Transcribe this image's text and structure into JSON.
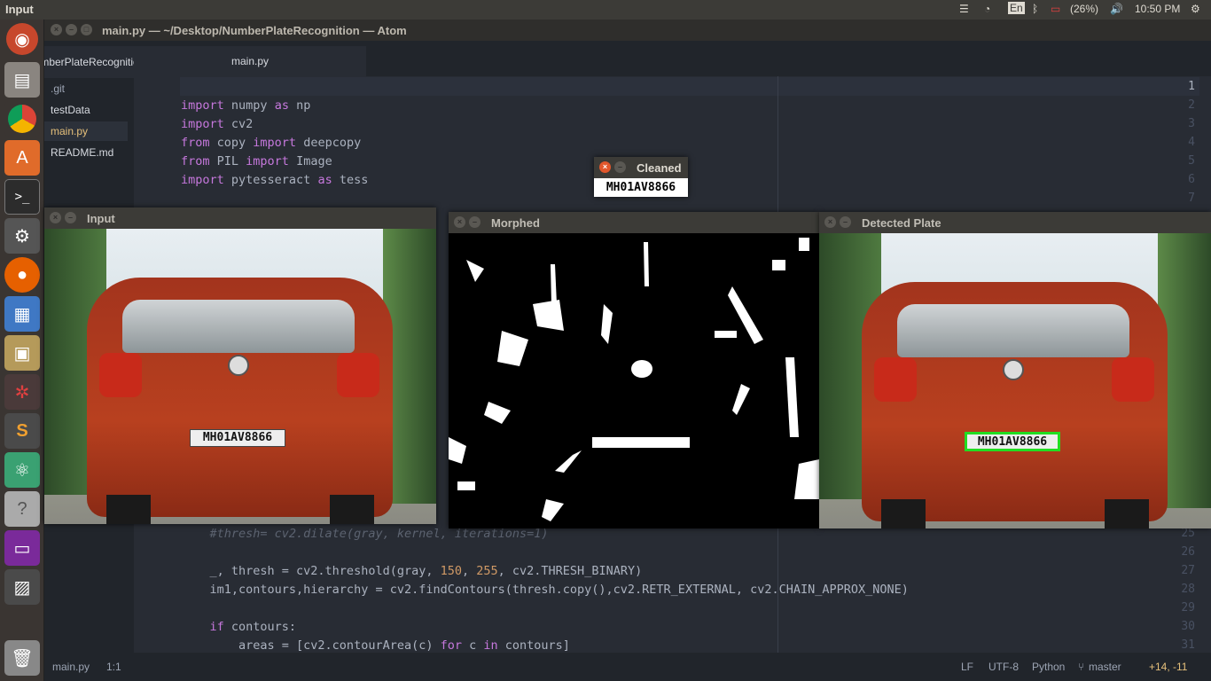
{
  "topbar": {
    "app_name": "Input",
    "keyboard": "En",
    "battery": "(26%)",
    "time": "10:50 PM"
  },
  "launcher": {
    "items": [
      "ubuntu-dash-icon",
      "files-icon",
      "chrome-icon",
      "software-center-icon",
      "terminal-icon",
      "settings-icon",
      "firefox-icon",
      "document-viewer-icon",
      "archive-icon",
      "unity-tweak-icon",
      "sublime-icon",
      "atom-icon",
      "help-icon",
      "window-icon",
      "workspace-icon",
      "trash-icon"
    ]
  },
  "atom": {
    "title": "main.py — ~/Desktop/NumberPlateRecognition — Atom",
    "tree_root": "NumberPlateRecognition",
    "tree_items": [
      ".git",
      "testData",
      "main.py",
      "README.md"
    ],
    "tab": "main.py"
  },
  "code": {
    "top_lines": [
      {
        "n": "1",
        "text": ""
      },
      {
        "n": "2",
        "text": "import numpy as np"
      },
      {
        "n": "3",
        "text": "import cv2"
      },
      {
        "n": "4",
        "text": "from copy import deepcopy"
      },
      {
        "n": "5",
        "text": "from PIL import Image"
      },
      {
        "n": "6",
        "text": "import pytesseract as tess"
      },
      {
        "n": "7",
        "text": ""
      }
    ],
    "bottom_lines": [
      {
        "n": "25",
        "text": "    #thresh= cv2.dilate(gray, kernel, iterations=1)"
      },
      {
        "n": "26",
        "text": ""
      },
      {
        "n": "27",
        "text": "    _, thresh = cv2.threshold(gray, 150, 255, cv2.THRESH_BINARY)"
      },
      {
        "n": "28",
        "text": "    im1,contours,hierarchy = cv2.findContours(thresh.copy(),cv2.RETR_EXTERNAL, cv2.CHAIN_APPROX_NONE)"
      },
      {
        "n": "29",
        "text": ""
      },
      {
        "n": "30",
        "text": "    if contours:"
      },
      {
        "n": "31",
        "text": "        areas = [cv2.contourArea(c) for c in contours]"
      }
    ]
  },
  "statusbar": {
    "file": "main.py",
    "cursor": "1:1",
    "line_ending": "LF",
    "encoding": "UTF-8",
    "grammar": "Python",
    "branch": "master",
    "diff": "+14, -11"
  },
  "windows": {
    "input": {
      "title": "Input",
      "plate_text": "MH01AV8866"
    },
    "morphed": {
      "title": "Morphed"
    },
    "detected": {
      "title": "Detected Plate",
      "plate_text": "MH01AV8866"
    },
    "cleaned": {
      "title": "Cleaned",
      "plate_text": "MH01AV8866"
    }
  }
}
